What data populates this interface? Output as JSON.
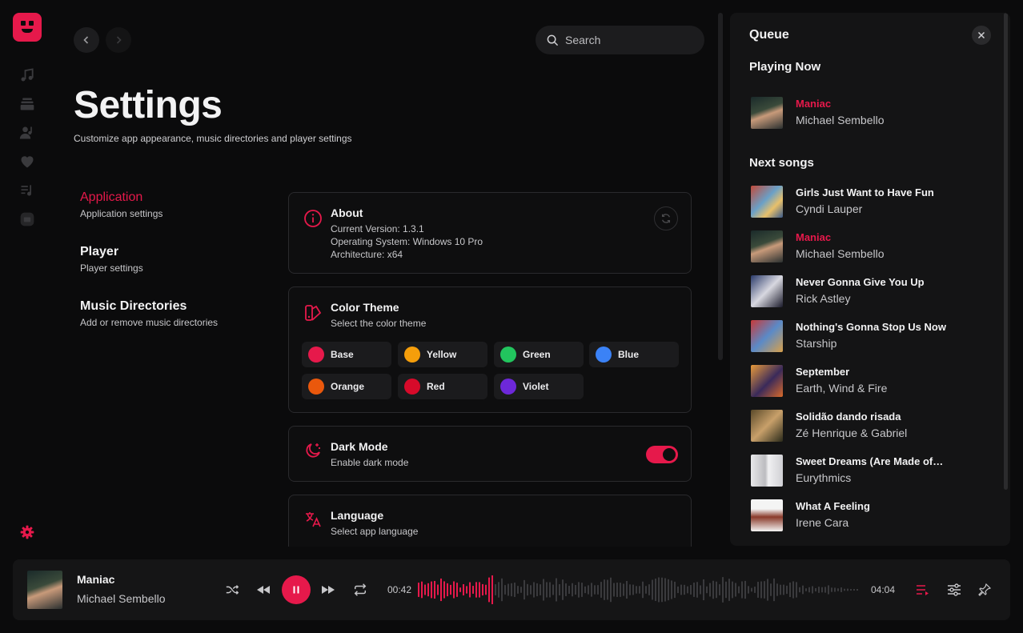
{
  "app": {
    "accent": "#e6194b",
    "rail_icons": [
      "music-note-icon",
      "albums-icon",
      "artists-icon",
      "heart-icon",
      "playlist-icon",
      "folder-icon"
    ],
    "settings_icon": "gear-icon"
  },
  "nav": {
    "search_placeholder": "Search"
  },
  "page": {
    "title": "Settings",
    "subtitle": "Customize app appearance, music directories and player settings"
  },
  "sections": [
    {
      "title": "Application",
      "desc": "Application settings",
      "active": true
    },
    {
      "title": "Player",
      "desc": "Player settings",
      "active": false
    },
    {
      "title": "Music Directories",
      "desc": "Add or remove music directories",
      "active": false
    }
  ],
  "about": {
    "title": "About",
    "version": "Current Version: 1.3.1",
    "os": "Operating System: Windows 10 Pro",
    "arch": "Architecture: x64"
  },
  "color_theme": {
    "title": "Color Theme",
    "desc": "Select the color theme",
    "themes": [
      {
        "name": "Base",
        "color": "#e6194b"
      },
      {
        "name": "Yellow",
        "color": "#f59e0b"
      },
      {
        "name": "Green",
        "color": "#22c55e"
      },
      {
        "name": "Blue",
        "color": "#3b82f6"
      },
      {
        "name": "Orange",
        "color": "#ea580c"
      },
      {
        "name": "Red",
        "color": "#d70a2a"
      },
      {
        "name": "Violet",
        "color": "#6d28d9"
      }
    ]
  },
  "dark_mode": {
    "title": "Dark Mode",
    "desc": "Enable dark mode",
    "enabled": true
  },
  "language": {
    "title": "Language",
    "desc": "Select app language"
  },
  "queue": {
    "title": "Queue",
    "playing_now_label": "Playing Now",
    "next_label": "Next songs",
    "now": {
      "title": "Maniac",
      "artist": "Michael Sembello"
    },
    "next": [
      {
        "title": "Girls Just Want to Have Fun",
        "artist": "Cyndi Lauper",
        "playing": false
      },
      {
        "title": "Maniac",
        "artist": "Michael Sembello",
        "playing": true
      },
      {
        "title": "Never Gonna Give You Up",
        "artist": "Rick Astley",
        "playing": false
      },
      {
        "title": "Nothing's Gonna Stop Us Now",
        "artist": "Starship",
        "playing": false
      },
      {
        "title": "September",
        "artist": "Earth, Wind & Fire",
        "playing": false
      },
      {
        "title": "Solidão dando risada",
        "artist": "Zé Henrique & Gabriel",
        "playing": false
      },
      {
        "title": "Sweet Dreams (Are Made of…",
        "artist": "Eurythmics",
        "playing": false
      },
      {
        "title": "What A Feeling",
        "artist": "Irene Cara",
        "playing": false
      }
    ]
  },
  "player": {
    "title": "Maniac",
    "artist": "Michael Sembello",
    "elapsed": "00:42",
    "duration": "04:04",
    "progress": 0.172
  }
}
